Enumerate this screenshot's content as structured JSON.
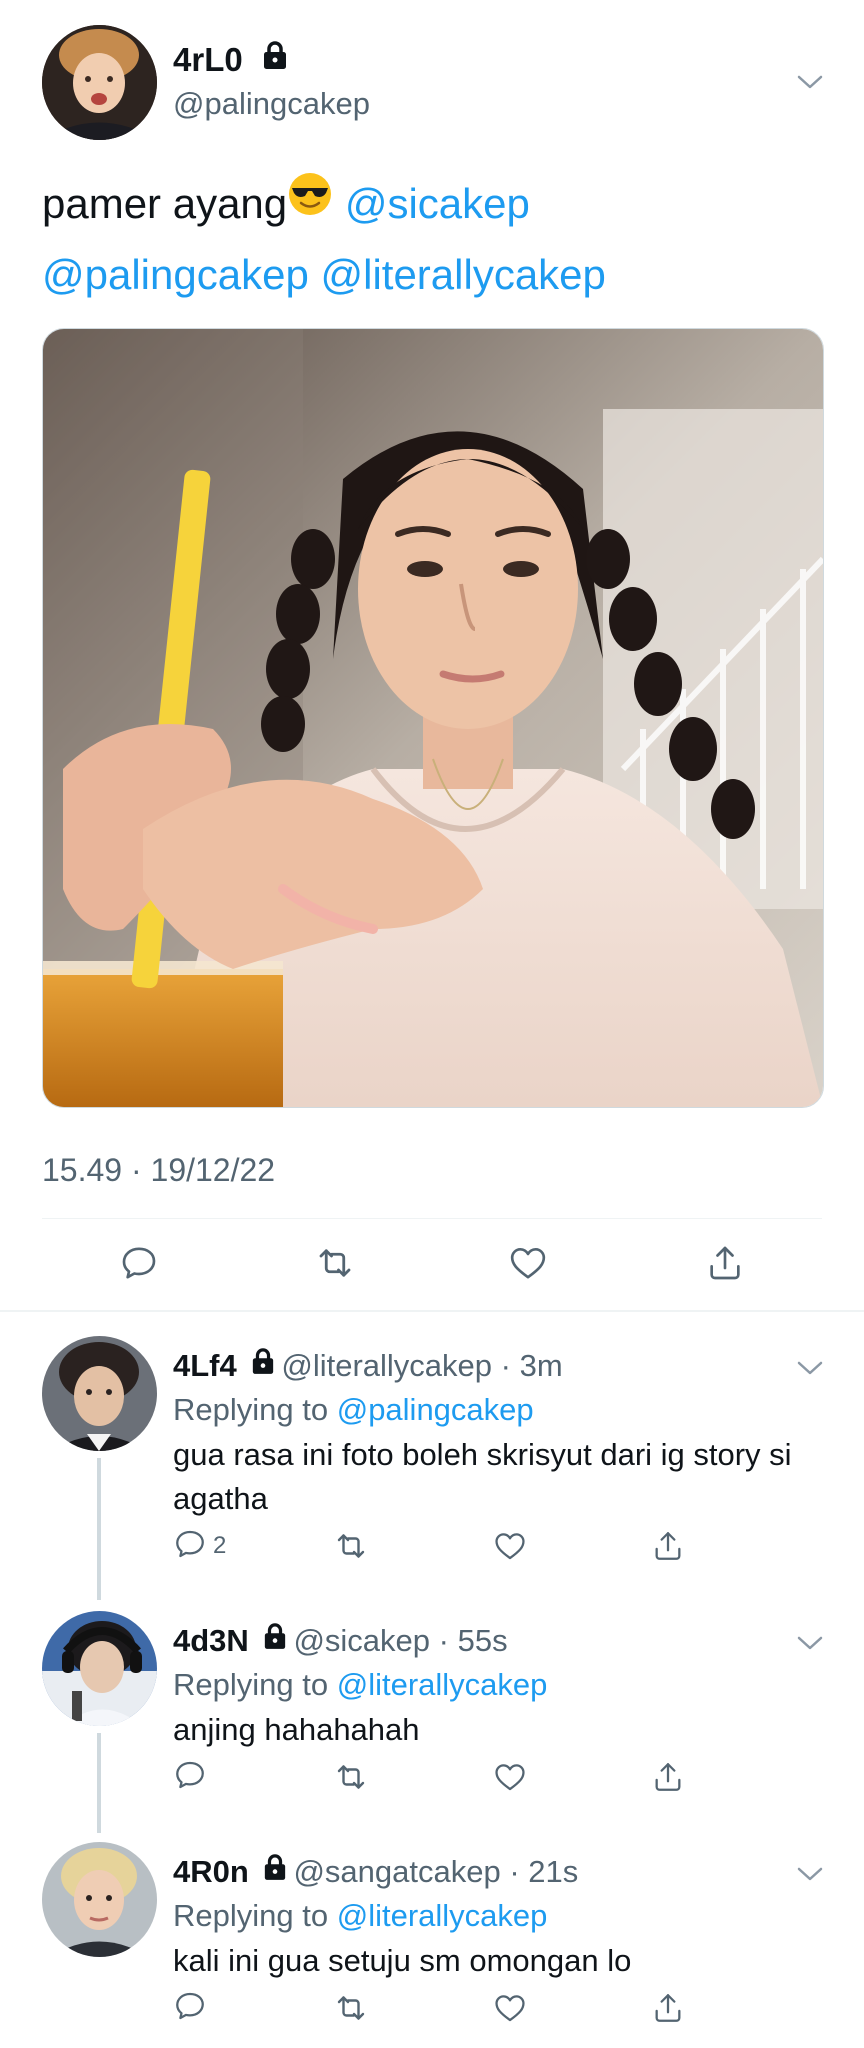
{
  "main_tweet": {
    "display_name": "4rL0",
    "handle": "@palingcakep",
    "text_before": "pamer ayang",
    "emoji": "smiling-face-with-sunglasses",
    "mention_1": "@sicakep",
    "mention_2": "@palingcakep",
    "mention_3": "@literallycakep",
    "timestamp": "15.49 · 19/12/22",
    "actions": [
      "reply-icon",
      "retweet-icon",
      "like-icon",
      "share-icon"
    ]
  },
  "replies": [
    {
      "display_name": "4Lf4",
      "handle": "@literallycakep",
      "time": "3m",
      "replying_label": "Replying to",
      "replying_to": "@palingcakep",
      "text": "gua rasa ini foto boleh skrisyut dari ig story si agatha",
      "reply_count": "2"
    },
    {
      "display_name": "4d3N",
      "handle": "@sicakep",
      "time": "55s",
      "replying_label": "Replying to",
      "replying_to": "@literallycakep",
      "text": "anjing hahahahah",
      "reply_count": ""
    },
    {
      "display_name": "4R0n",
      "handle": "@sangatcakep",
      "time": "21s",
      "replying_label": "Replying to",
      "replying_to": "@literallycakep",
      "text": "kali ini gua setuju sm omongan lo",
      "reply_count": ""
    }
  ],
  "colors": {
    "accent": "#1d9bf0",
    "secondary_text": "#536471",
    "primary_text": "#0f1419",
    "divider": "#eff3f4"
  }
}
